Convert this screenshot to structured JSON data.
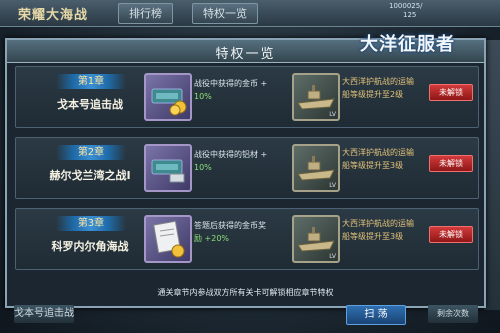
{
  "top": {
    "game_title": "荣耀大海战",
    "tabs": [
      "排行榜",
      "特权一览"
    ],
    "resource_value": "1000025/",
    "resource_sub": "125"
  },
  "logo_text": "大洋征服者",
  "dialog": {
    "title": "特权一览",
    "rows": [
      {
        "chapter": "第1章",
        "chapter_name": "戈本号追击战",
        "reward_line1": "战役中获得的金币 +",
        "reward_line2": "10%",
        "ship_line1": "大西洋护航战的运输",
        "ship_line2": "船等级提升至2级",
        "lock_label": "未解锁",
        "lv": "LV"
      },
      {
        "chapter": "第2章",
        "chapter_name": "赫尔戈兰湾之战I",
        "reward_line1": "战役中获得的铝材 +",
        "reward_line2": "10%",
        "ship_line1": "大西洋护航战的运输",
        "ship_line2": "船等级提升至3级",
        "lock_label": "未解锁",
        "lv": "LV"
      },
      {
        "chapter": "第3章",
        "chapter_name": "科罗内尔角海战",
        "reward_line1": "答题后获得的金币奖",
        "reward_line2": "励 +20%",
        "ship_line1": "大西洋护航战的运输",
        "ship_line2": "船等级提升至3级",
        "lock_label": "未解锁",
        "lv": "LV"
      }
    ],
    "footer_note": "通关章节内参战双方所有关卡可解锁相应章节特权"
  },
  "bottom": {
    "left_label": "戈本号追击战",
    "mid_label": "扫 荡",
    "right_label": "剩余次数"
  },
  "colors": {
    "accent_gold": "#e4c37a",
    "lock_red": "#c62828",
    "highlight_green": "#8ee07a"
  }
}
